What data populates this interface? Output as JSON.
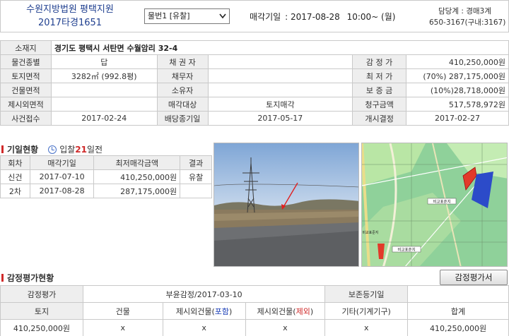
{
  "header": {
    "court_name": "수원지방법원 평택지원",
    "case_number": "2017타경1651",
    "item_select_value": "물번1 [유찰]",
    "auction_label": "매각기일",
    "auction_date": ": 2017-08-28",
    "auction_time": "10:00~ (월)",
    "dept": "담당계 : 경매3계",
    "phone": "650-3167(구내:3167)"
  },
  "info": {
    "location_label": "소재지",
    "location_value": "경기도 평택시 서탄면 수월암리 32-4",
    "rows": [
      {
        "l1": "물건종별",
        "v1": "답",
        "l2": "채 권 자",
        "v2": "",
        "l3": "감 정 가",
        "v3": "410,250,000원"
      },
      {
        "l1": "토지면적",
        "v1": "3282㎡ (992.8평)",
        "l2": "채무자",
        "v2": "",
        "l3": "최 저 가",
        "v3": "(70%) 287,175,000원"
      },
      {
        "l1": "건물면적",
        "v1": "",
        "l2": "소유자",
        "v2": "",
        "l3": "보 증 금",
        "v3": "(10%)28,718,000원"
      },
      {
        "l1": "제시외면적",
        "v1": "",
        "l2": "매각대상",
        "v2": "토지매각",
        "l3": "청구금액",
        "v3": "517,578,972원"
      },
      {
        "l1": "사건접수",
        "v1": "2017-02-24",
        "l2": "배당종기일",
        "v2": "2017-05-17",
        "l3": "개시결정",
        "v3": "2017-02-27"
      }
    ]
  },
  "bid_history": {
    "title": "기일현황",
    "days_prefix": "입찰",
    "days_count": "21",
    "days_suffix": "일전",
    "headers": [
      "회차",
      "매각기일",
      "최저매각금액",
      "결과"
    ],
    "rows": [
      {
        "round": "신건",
        "date": "2017-07-10",
        "price": "410,250,000원",
        "result": "유찰"
      },
      {
        "round": "2차",
        "date": "2017-08-28",
        "price": "287,175,000원",
        "result": ""
      }
    ]
  },
  "map": {
    "label_1": "비교표준지",
    "label_2": "비교표준지",
    "label_3": "비교표준지"
  },
  "appraisal": {
    "title": "감정평가현황",
    "button": "감정평가서",
    "row1": {
      "l1": "감정평가",
      "v1": "부윤감정/2017-03-10",
      "l2": "보존등기일",
      "v2": ""
    },
    "headers": {
      "land": "토지",
      "building": "건물",
      "extra_incl_pre": "제시외건물(",
      "extra_incl_word": "포함",
      "extra_excl_pre": "제시외건물(",
      "extra_excl_word": "제외",
      "close": ")",
      "etc": "기타(기계기구)",
      "total": "합계"
    },
    "values": {
      "land": "410,250,000원",
      "building": "x",
      "extra_incl": "x",
      "extra_excl": "x",
      "etc": "x",
      "total": "410,250,000원"
    }
  },
  "colors": {
    "accent_red": "#d02a2a",
    "court_blue": "#1f3f8f",
    "label_bg": "#eeeeee"
  }
}
